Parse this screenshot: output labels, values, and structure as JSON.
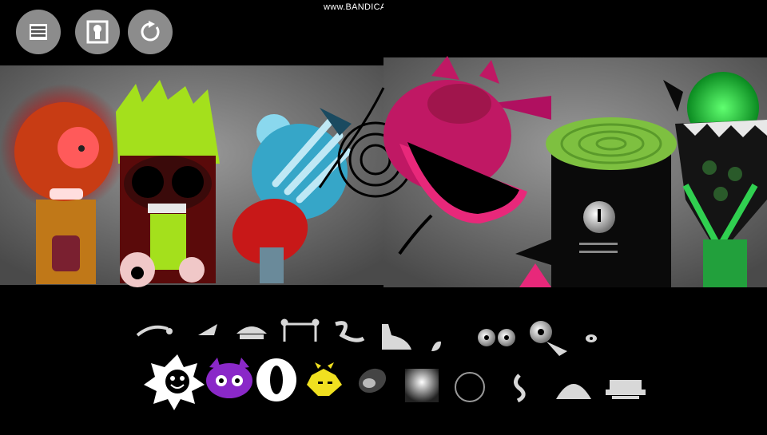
{
  "watermark": {
    "text": "www.BANDICAM.com"
  },
  "top_buttons": [
    {
      "id": "menu",
      "icon": "list-menu-icon"
    },
    {
      "id": "keyhole",
      "icon": "keyhole-icon"
    },
    {
      "id": "reset",
      "icon": "reset-arrow-icon"
    }
  ],
  "characters": [
    {
      "id": "red-cyclops",
      "color": "#e02020"
    },
    {
      "id": "green-spiky-skull",
      "color": "#a4e01c"
    },
    {
      "id": "blue-horn",
      "color": "#36a6c8"
    },
    {
      "id": "magenta-demon",
      "color": "#c01864"
    },
    {
      "id": "stump-head",
      "color": "#6ab83c"
    },
    {
      "id": "green-glow-monster",
      "color": "#22c83c"
    }
  ],
  "sound_icons_row1": [
    "arc-whip",
    "wedge",
    "mushroom-cap",
    "headband",
    "hook",
    "boot",
    "drop",
    "eyes-pair",
    "eyeball-stalk",
    "small-eye"
  ],
  "sound_icons_row2": [
    "spiky-star-face",
    "purple-devil-face",
    "white-ring",
    "yellow-horned-star",
    "pill-orb",
    "glow-box",
    "thin-ring",
    "curl",
    "dome",
    "hat-block"
  ],
  "colors": {
    "background": "#000000",
    "button": "#8c8c8c",
    "stage_gray": "#707070"
  }
}
